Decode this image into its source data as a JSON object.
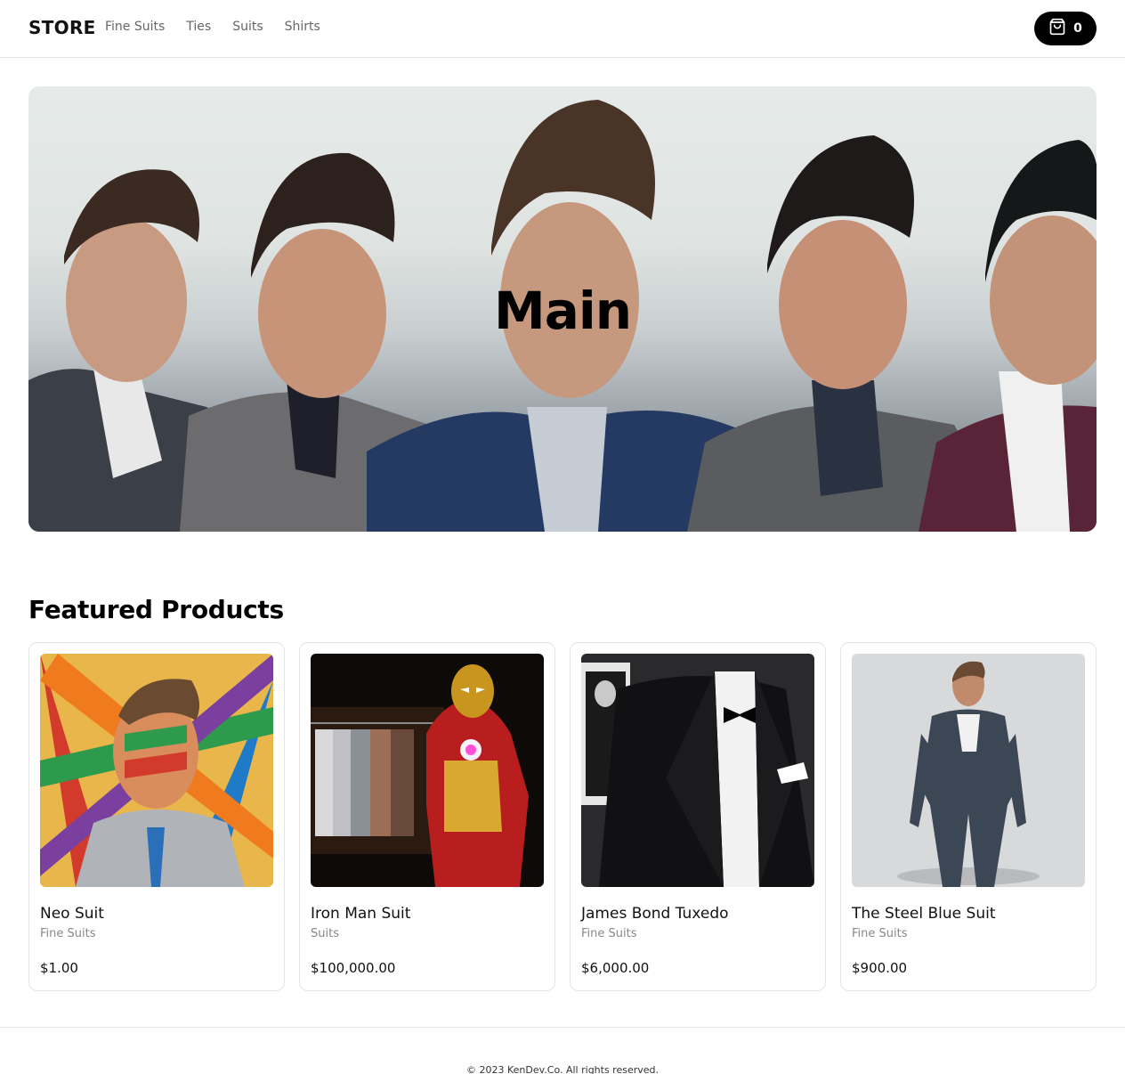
{
  "header": {
    "logo": "STORE",
    "nav": [
      "Fine Suits",
      "Ties",
      "Suits",
      "Shirts"
    ],
    "cart_count": "0"
  },
  "hero": {
    "title": "Main",
    "image": "five men in suits"
  },
  "featured": {
    "title": "Featured Products",
    "products": [
      {
        "name": "Neo Suit",
        "category": "Fine Suits",
        "price": "$1.00",
        "image": "colorful ribbon suit portrait"
      },
      {
        "name": "Iron Man Suit",
        "category": "Suits",
        "price": "$100,000.00",
        "image": "iron man armor beside suit rack"
      },
      {
        "name": "James Bond Tuxedo",
        "category": "Fine Suits",
        "price": "$6,000.00",
        "image": "black tuxedo with bow tie"
      },
      {
        "name": "The Steel Blue Suit",
        "category": "Fine Suits",
        "price": "$900.00",
        "image": "man in steel blue suit"
      }
    ]
  },
  "footer": {
    "copyright": "© 2023 KenDev.Co. All rights reserved."
  },
  "colors": {
    "primary": "#000000",
    "muted_text": "#888888",
    "border": "#e5e5e5"
  }
}
